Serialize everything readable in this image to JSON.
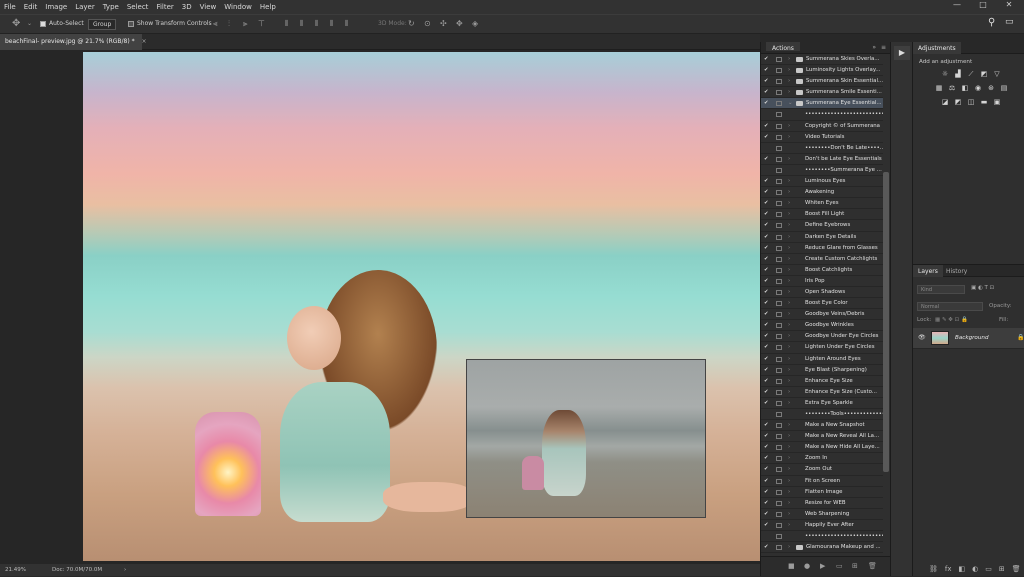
{
  "menu": [
    "File",
    "Edit",
    "Image",
    "Layer",
    "Type",
    "Select",
    "Filter",
    "3D",
    "View",
    "Window",
    "Help"
  ],
  "window_controls": {
    "minimize": "—",
    "maximize": "□",
    "close": "✕"
  },
  "options": {
    "auto_select_label": "Auto-Select",
    "auto_select_value": "Group",
    "transform_label": "Show Transform Controls",
    "mode_3d": "3D Mode:"
  },
  "document": {
    "tab": "beachFinal- preview.jpg @ 21.7% (RGB/8) *",
    "close": "×"
  },
  "status": {
    "zoom": "21.49%",
    "doc": "Doc: 70.0M/70.0M",
    "arrow": "›"
  },
  "actions_panel": {
    "tab": "Actions",
    "rows": [
      {
        "check": "✔",
        "expand": "›",
        "folder": true,
        "label": "Summerana Skies Overla..."
      },
      {
        "check": "✔",
        "expand": "›",
        "folder": true,
        "label": "Luminosity Lights Overlay..."
      },
      {
        "check": "✔",
        "expand": "›",
        "folder": true,
        "label": "Summerana Skin Essential..."
      },
      {
        "check": "✔",
        "expand": "›",
        "folder": true,
        "label": "Summerana Smile Essenti..."
      },
      {
        "check": "✔",
        "expand": "⌄",
        "folder": true,
        "label": "Summerana Eye Essential...",
        "selected": true
      },
      {
        "check": "",
        "expand": "",
        "folder": false,
        "label": "••••••••••••••••••••••••••••"
      },
      {
        "check": "✔",
        "expand": "›",
        "folder": false,
        "label": "Copyright © of Summerana"
      },
      {
        "check": "✔",
        "expand": "›",
        "folder": false,
        "label": "Video Tutorials"
      },
      {
        "check": "",
        "expand": "",
        "folder": false,
        "label": "••••••••Don't Be Late••••..."
      },
      {
        "check": "✔",
        "expand": "›",
        "folder": false,
        "label": "Don't be Late Eye Essentials"
      },
      {
        "check": "",
        "expand": "",
        "folder": false,
        "label": "••••••••Summerana Eye ..."
      },
      {
        "check": "✔",
        "expand": "›",
        "folder": false,
        "label": "Luminous Eyes"
      },
      {
        "check": "✔",
        "expand": "›",
        "folder": false,
        "label": "Awakening"
      },
      {
        "check": "✔",
        "expand": "›",
        "folder": false,
        "label": "Whiten Eyes"
      },
      {
        "check": "✔",
        "expand": "›",
        "folder": false,
        "label": "Boost Fill Light"
      },
      {
        "check": "✔",
        "expand": "›",
        "folder": false,
        "label": "Define Eyebrows"
      },
      {
        "check": "✔",
        "expand": "›",
        "folder": false,
        "label": "Darken Eye Details"
      },
      {
        "check": "✔",
        "expand": "›",
        "folder": false,
        "label": "Reduce Glare from Glasses"
      },
      {
        "check": "✔",
        "expand": "›",
        "folder": false,
        "label": "Create Custom Catchlights"
      },
      {
        "check": "✔",
        "expand": "›",
        "folder": false,
        "label": "Boost Catchlights"
      },
      {
        "check": "✔",
        "expand": "›",
        "folder": false,
        "label": "Iris Pop"
      },
      {
        "check": "✔",
        "expand": "›",
        "folder": false,
        "label": "Open Shadows"
      },
      {
        "check": "✔",
        "expand": "›",
        "folder": false,
        "label": "Boost Eye Color"
      },
      {
        "check": "✔",
        "expand": "›",
        "folder": false,
        "label": "Goodbye Veins/Debris"
      },
      {
        "check": "✔",
        "expand": "›",
        "folder": false,
        "label": "Goodbye Wrinkles"
      },
      {
        "check": "✔",
        "expand": "›",
        "folder": false,
        "label": "Goodbye Under Eye Circles"
      },
      {
        "check": "✔",
        "expand": "›",
        "folder": false,
        "label": "Lighten Under Eye Circles"
      },
      {
        "check": "✔",
        "expand": "›",
        "folder": false,
        "label": "Lighten Around Eyes"
      },
      {
        "check": "✔",
        "expand": "›",
        "folder": false,
        "label": "Eye Blast (Sharpening)"
      },
      {
        "check": "✔",
        "expand": "›",
        "folder": false,
        "label": "Enhance Eye Size"
      },
      {
        "check": "✔",
        "expand": "›",
        "folder": false,
        "label": "Enhance Eye Size (Custo..."
      },
      {
        "check": "✔",
        "expand": "›",
        "folder": false,
        "label": "Extra Eye Sparkle"
      },
      {
        "check": "",
        "expand": "",
        "folder": false,
        "label": "••••••••Tools••••••••••••••••"
      },
      {
        "check": "✔",
        "expand": "›",
        "folder": false,
        "label": "Make a New Snapshot"
      },
      {
        "check": "✔",
        "expand": "›",
        "folder": false,
        "label": "Make a New Reveal All La..."
      },
      {
        "check": "✔",
        "expand": "›",
        "folder": false,
        "label": "Make a New Hide All Laye..."
      },
      {
        "check": "✔",
        "expand": "›",
        "folder": false,
        "label": "Zoom In"
      },
      {
        "check": "✔",
        "expand": "›",
        "folder": false,
        "label": "Zoom Out"
      },
      {
        "check": "✔",
        "expand": "›",
        "folder": false,
        "label": "Fit on Screen"
      },
      {
        "check": "✔",
        "expand": "›",
        "folder": false,
        "label": "Flatten Image"
      },
      {
        "check": "✔",
        "expand": "›",
        "folder": false,
        "label": "Resize for WEB"
      },
      {
        "check": "✔",
        "expand": "›",
        "folder": false,
        "label": "Web Sharpening"
      },
      {
        "check": "✔",
        "expand": "›",
        "folder": false,
        "label": "Happily Ever After"
      },
      {
        "check": "",
        "expand": "",
        "folder": false,
        "label": "••••••••••••••••••••••••••••••"
      },
      {
        "check": "✔",
        "expand": "›",
        "folder": true,
        "label": "Glamourana Makeup and ..."
      }
    ],
    "footer_icons": [
      "■",
      "●",
      "▶",
      "▭",
      "⊞",
      "🗑"
    ]
  },
  "adjustments_panel": {
    "tab": "Adjustments",
    "subtitle": "Add an adjustment"
  },
  "layers_panel": {
    "tabs": [
      "Layers",
      "History"
    ],
    "kind": "Kind",
    "blend": "Normal",
    "opacity_label": "Opacity:",
    "lock_label": "Lock:",
    "fill_label": "Fill:",
    "layer_name": "Background",
    "footer_icons": [
      "⛓",
      "fx",
      "◧",
      "◐",
      "▭",
      "⊞",
      "🗑"
    ]
  },
  "colors": {
    "selected_row": "#47505c",
    "panel": "#2f2f2f",
    "menubar": "#323232"
  }
}
